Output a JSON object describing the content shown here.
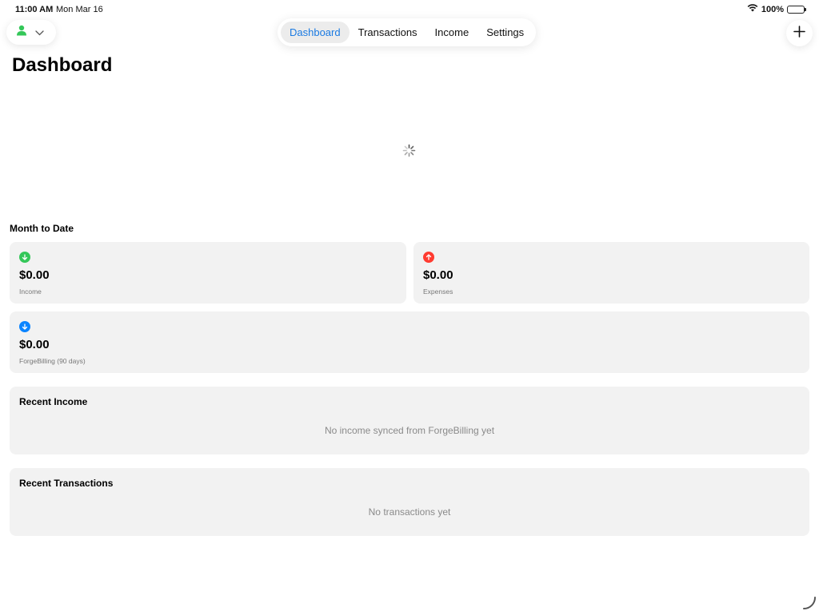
{
  "status_bar": {
    "time": "11:00 AM",
    "date": "Mon Mar 16",
    "battery": "100%"
  },
  "nav": {
    "tabs": [
      {
        "label": "Dashboard",
        "active": true
      },
      {
        "label": "Transactions",
        "active": false
      },
      {
        "label": "Income",
        "active": false
      },
      {
        "label": "Settings",
        "active": false
      }
    ],
    "account_icon": "person-icon",
    "add_icon": "plus-icon"
  },
  "page": {
    "title": "Dashboard"
  },
  "month_to_date": {
    "heading": "Month to Date",
    "cards": [
      {
        "amount": "$0.00",
        "label": "Income",
        "icon": "arrow-down-circle-icon",
        "color": "#34c759"
      },
      {
        "amount": "$0.00",
        "label": "Expenses",
        "icon": "arrow-up-circle-icon",
        "color": "#ff3b30"
      },
      {
        "amount": "$0.00",
        "label": "ForgeBilling (90 days)",
        "icon": "arrow-down-circle-icon",
        "color": "#0a84ff"
      }
    ]
  },
  "recent_income": {
    "title": "Recent Income",
    "empty_text": "No income synced from ForgeBilling yet"
  },
  "recent_transactions": {
    "title": "Recent Transactions",
    "empty_text": "No transactions yet"
  },
  "colors": {
    "accent": "#1a7ae2",
    "income": "#34c759",
    "expense": "#ff3b30",
    "forgebilling": "#0a84ff",
    "card_bg": "#f2f2f2"
  }
}
